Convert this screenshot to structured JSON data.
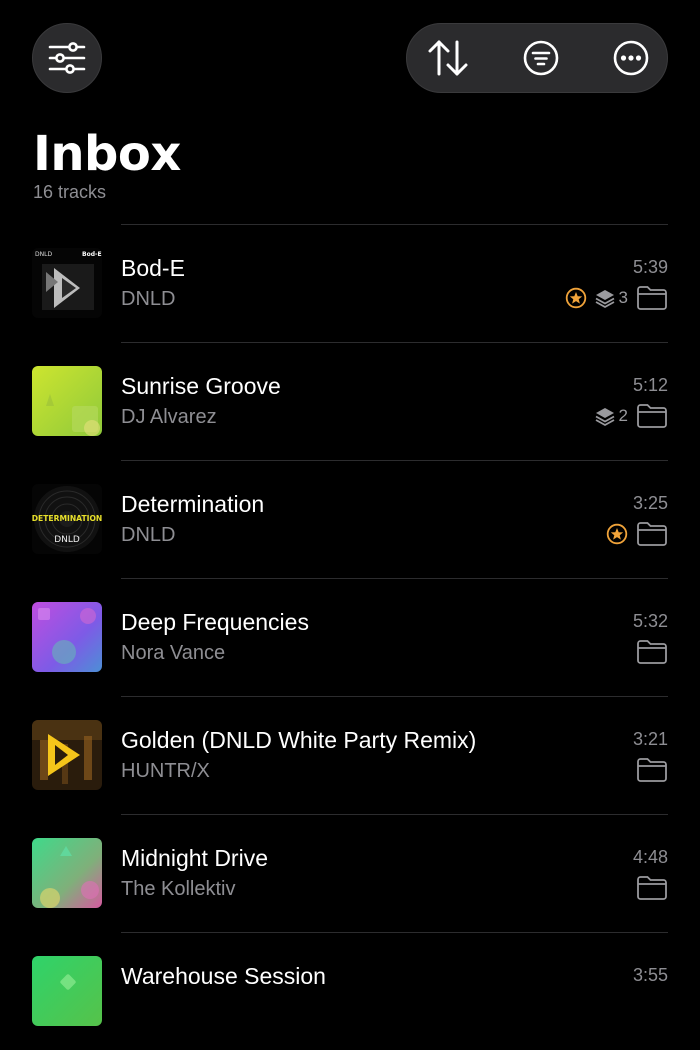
{
  "header": {
    "title": "Inbox",
    "subtitle": "16 tracks"
  },
  "colors": {
    "background": "#000000",
    "button_bg": "#2b2b2d",
    "secondary_text": "#8e8e93",
    "star_accent": "#f0a33a",
    "divider": "#2c2c2e"
  },
  "icons": {
    "settings": "sliders-icon",
    "sort": "sort-arrows-icon",
    "filter": "filter-icon",
    "more": "more-icon",
    "star": "star-badge-icon",
    "stack": "stack-icon",
    "folder": "folder-icon"
  },
  "tracks": [
    {
      "title": "Bod-E",
      "artist": "DNLD",
      "duration": "5:39",
      "starred": true,
      "stack_count": "3"
    },
    {
      "title": "Sunrise Groove",
      "artist": "DJ Alvarez",
      "duration": "5:12",
      "starred": false,
      "stack_count": "2"
    },
    {
      "title": "Determination",
      "artist": "DNLD",
      "duration": "3:25",
      "starred": true,
      "stack_count": null
    },
    {
      "title": "Deep Frequencies",
      "artist": "Nora Vance",
      "duration": "5:32",
      "starred": false,
      "stack_count": null
    },
    {
      "title": "Golden (DNLD White Party Remix)",
      "artist": "HUNTR/X",
      "duration": "3:21",
      "starred": false,
      "stack_count": null
    },
    {
      "title": "Midnight Drive",
      "artist": "The Kollektiv",
      "duration": "4:48",
      "starred": false,
      "stack_count": null
    },
    {
      "title": "Warehouse Session",
      "artist": "",
      "duration": "3:55",
      "starred": false,
      "stack_count": null
    }
  ],
  "artwork": {
    "bod_e": {
      "left_text": "DNLD",
      "right_text": "Bod-E"
    },
    "determination": {
      "word": "DETERMINATION",
      "label": "DNLD"
    }
  }
}
